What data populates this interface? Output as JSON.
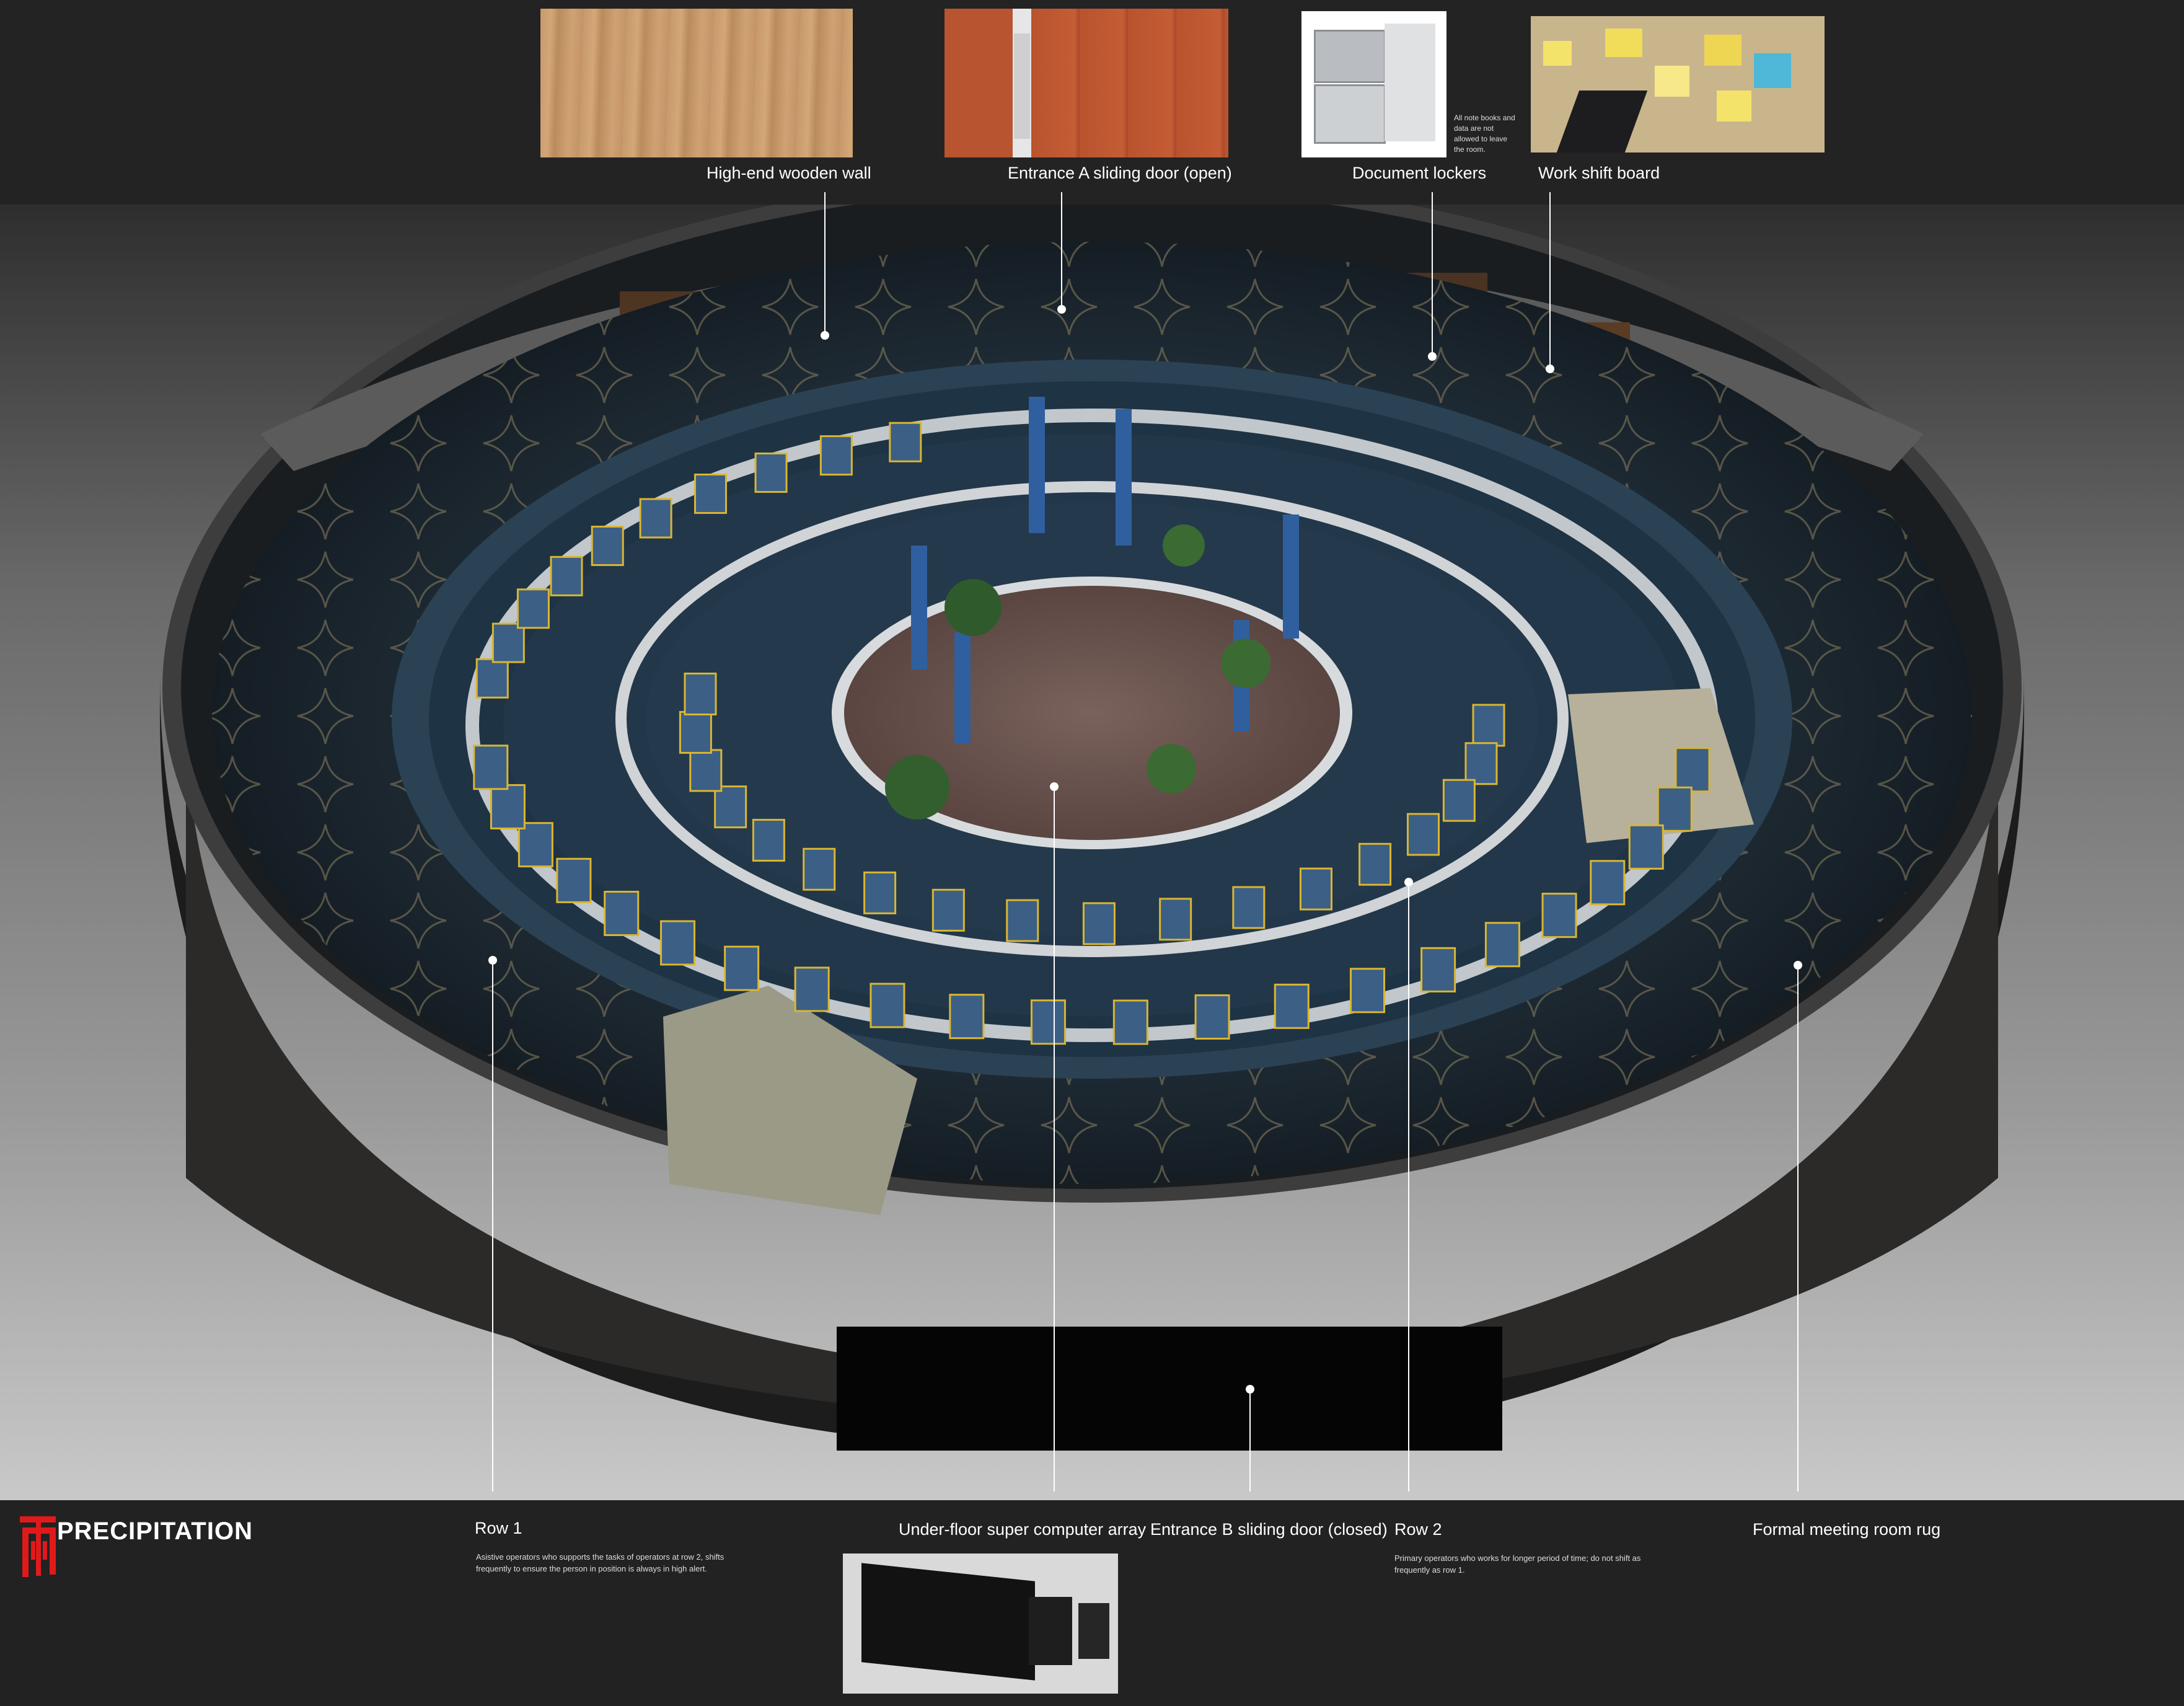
{
  "callouts_top": [
    {
      "label": "High-end wooden wall",
      "image_icon": "wood-panel-photo"
    },
    {
      "label": "Entrance A sliding door (open)",
      "image_icon": "sliding-door-photo"
    },
    {
      "label": "Document lockers",
      "image_icon": "locker-photo",
      "note": "All note books and data are not allowed to leave the room."
    },
    {
      "label": "Work shift board",
      "image_icon": "sticky-note-board-photo"
    }
  ],
  "callouts_bottom": [
    {
      "label": "Row 1",
      "note": "Asistive operators who supports the tasks of operators at row 2, shifts frequently to ensure the person in position is always in high alert."
    },
    {
      "label": "Under-floor super computer array",
      "image_icon": "server-rack-photo"
    },
    {
      "label": "Entrance B sliding door (closed)"
    },
    {
      "label": "Row 2",
      "note": "Primary operators who works for longer period of time; do not shift as frequently as row 1."
    },
    {
      "label": "Formal meeting room rug"
    }
  ],
  "brand": {
    "name": "PRECIPITATION",
    "mark_icon": "rain-glyph-logo"
  },
  "colors": {
    "carpet": "#1f3446",
    "floor_center": "#6d5652",
    "wood": "#5a3b23",
    "flag": "#2f5f9e",
    "chair": "#3c5f86",
    "marking": "#d9b632"
  }
}
